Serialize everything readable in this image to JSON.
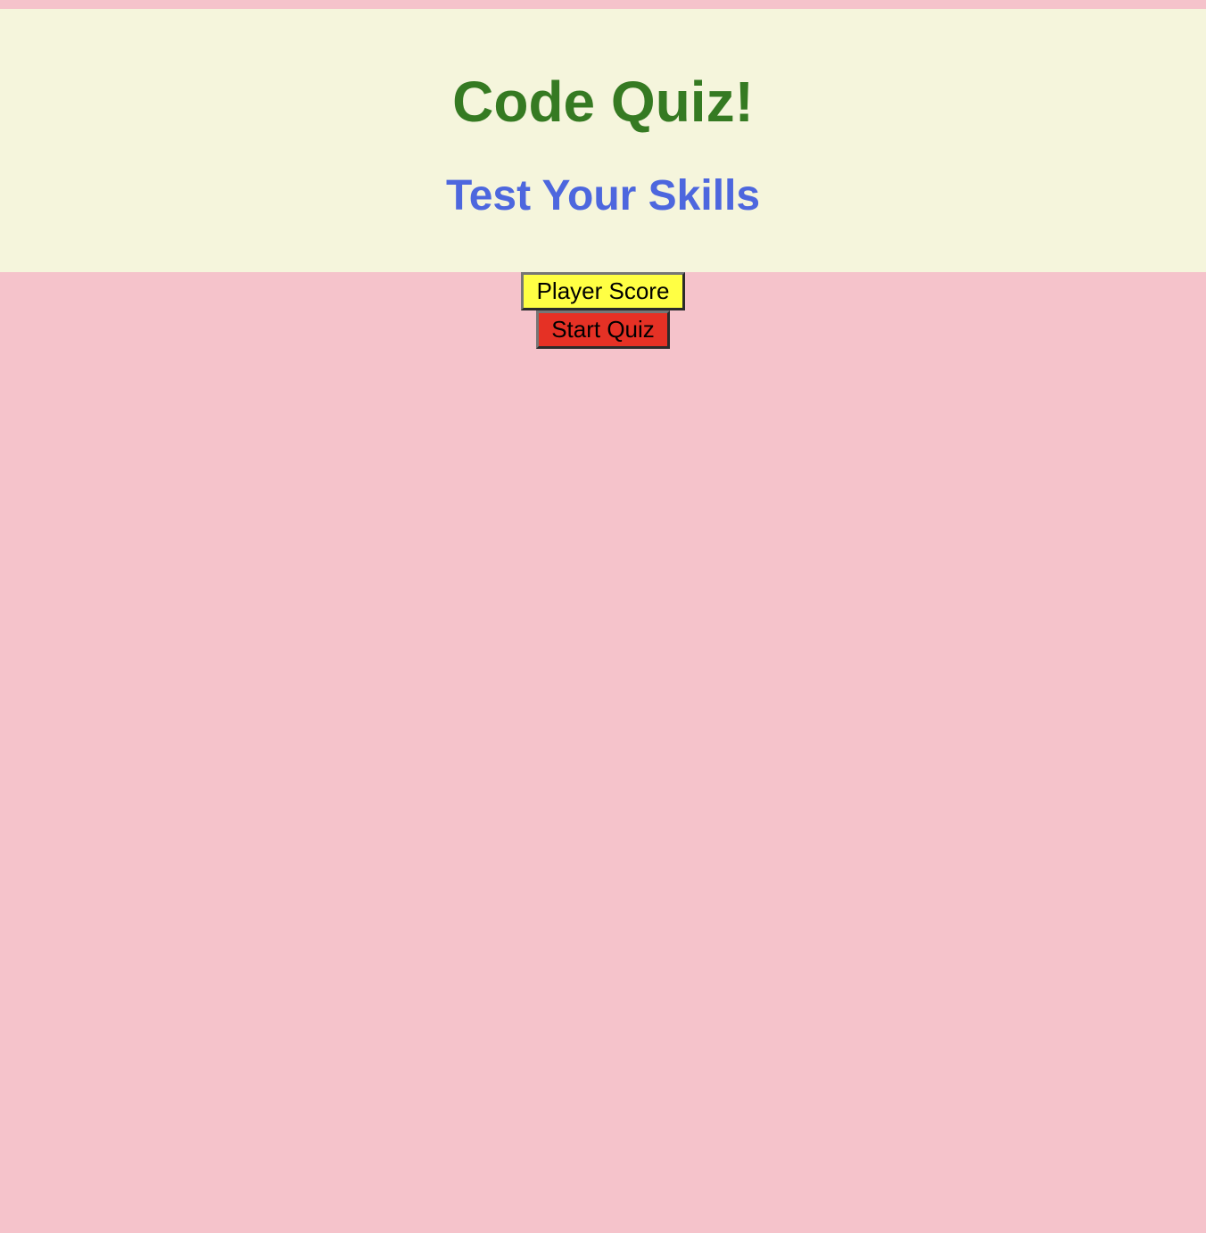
{
  "header": {
    "title": "Code Quiz!",
    "subtitle": "Test Your Skills"
  },
  "actions": {
    "player_score_label": "Player Score",
    "start_quiz_label": "Start Quiz"
  },
  "colors": {
    "page_background": "#f5c3cb",
    "header_background": "#f5f5dc",
    "title": "#357a22",
    "subtitle": "#4d67de",
    "player_score_button": "#ffff44",
    "start_quiz_button": "#e53125"
  }
}
